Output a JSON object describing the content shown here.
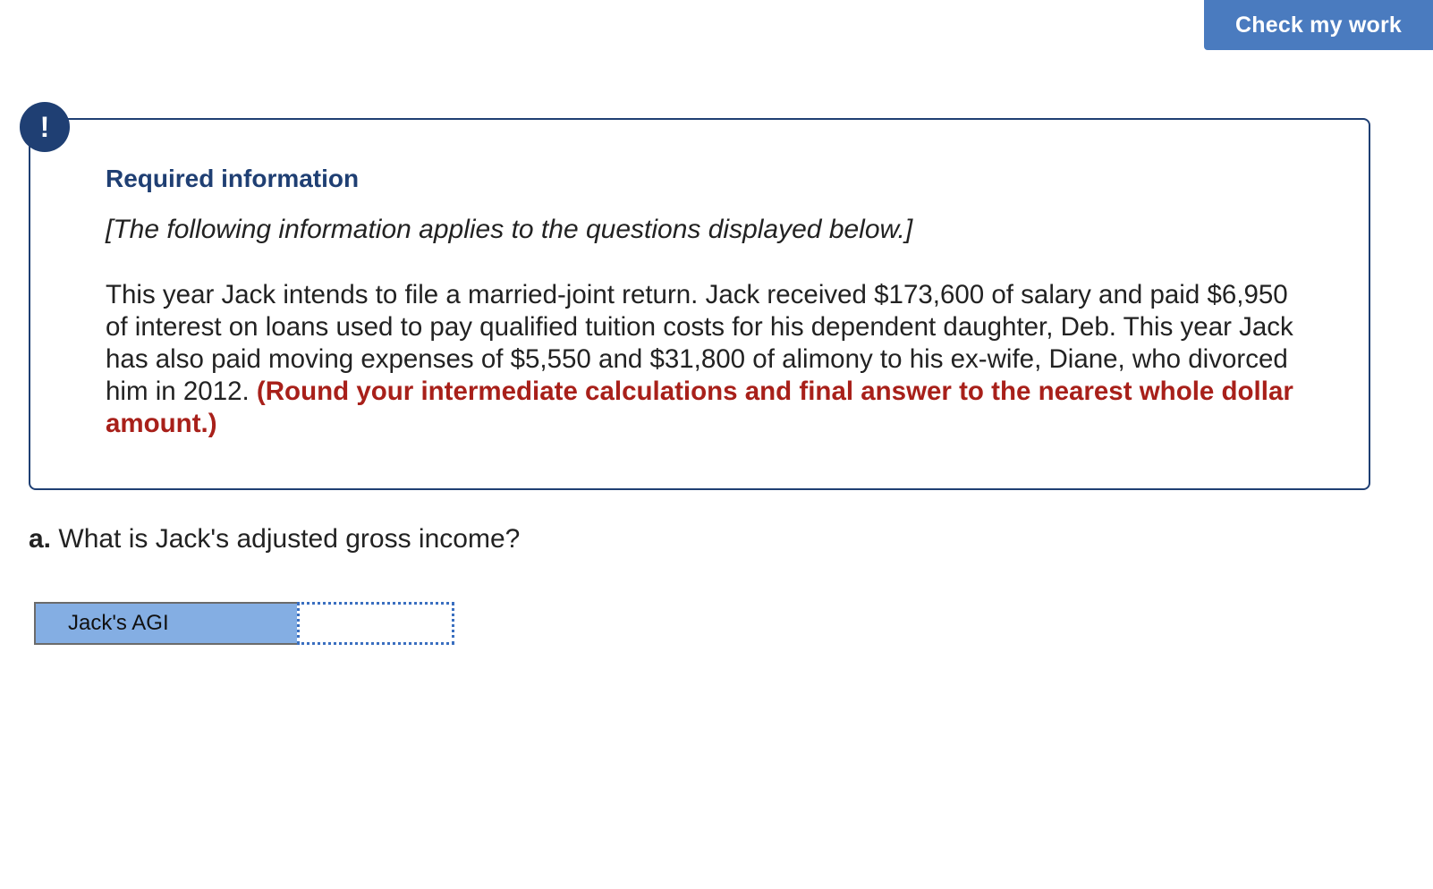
{
  "toolbar": {
    "check_label": "Check my work"
  },
  "alert": {
    "symbol": "!"
  },
  "info": {
    "title": "Required information",
    "subtitle": "[The following information applies to the questions displayed below.]",
    "body": "This year Jack intends to file a married-joint return. Jack received $173,600 of salary and paid $6,950 of interest on loans used to pay qualified tuition costs for his dependent daughter, Deb. This year Jack has also paid moving expenses of $5,550 and $31,800 of alimony to his ex-wife, Diane, who divorced him in 2012.",
    "note": "(Round your intermediate calculations and final answer to the nearest whole dollar amount.)"
  },
  "question": {
    "label": "a.",
    "text": "What is Jack's adjusted gross income?"
  },
  "answer": {
    "label": "Jack's AGI",
    "value": "",
    "placeholder": ""
  }
}
